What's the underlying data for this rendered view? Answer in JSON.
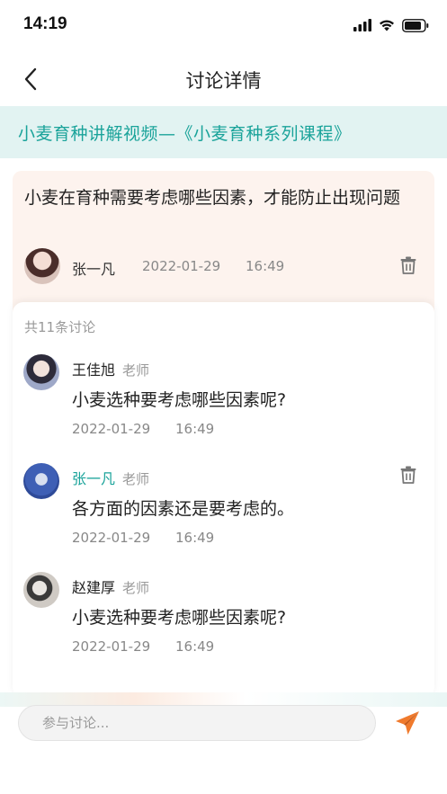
{
  "status_bar": {
    "time": "14:19",
    "icons": [
      "signal-icon",
      "wifi-icon",
      "battery-icon"
    ]
  },
  "nav": {
    "title": "讨论详情",
    "back_icon": "chevron-left-icon"
  },
  "course": {
    "title": "小麦育种讲解视频—《小麦育种系列课程》",
    "color": "#1aa39a",
    "background": "#e2f3f2"
  },
  "topic": {
    "question": "小麦在育种需要考虑哪些因素，才能防止出现问题",
    "author": "张一凡",
    "date": "2022-01-29",
    "time": "16:49",
    "delete_icon": "trash-icon"
  },
  "discussion": {
    "count_label": "共11条讨论",
    "comments": [
      {
        "name": "王佳旭",
        "role": "老师",
        "text": "小麦选种要考虑哪些因素呢?",
        "date": "2022-01-29",
        "time": "16:49"
      },
      {
        "name": "张一凡",
        "role": "老师",
        "text": "各方面的因素还是要考虑的。",
        "date": "2022-01-29",
        "time": "16:49",
        "deletable": true
      },
      {
        "name": "赵建厚",
        "role": "老师",
        "text": "小麦选种要考虑哪些因素呢?",
        "date": "2022-01-29",
        "time": "16:49"
      }
    ]
  },
  "input": {
    "placeholder": "参与讨论...",
    "value": "",
    "send_icon": "paper-plane-icon",
    "send_color": "#f07a2c"
  }
}
